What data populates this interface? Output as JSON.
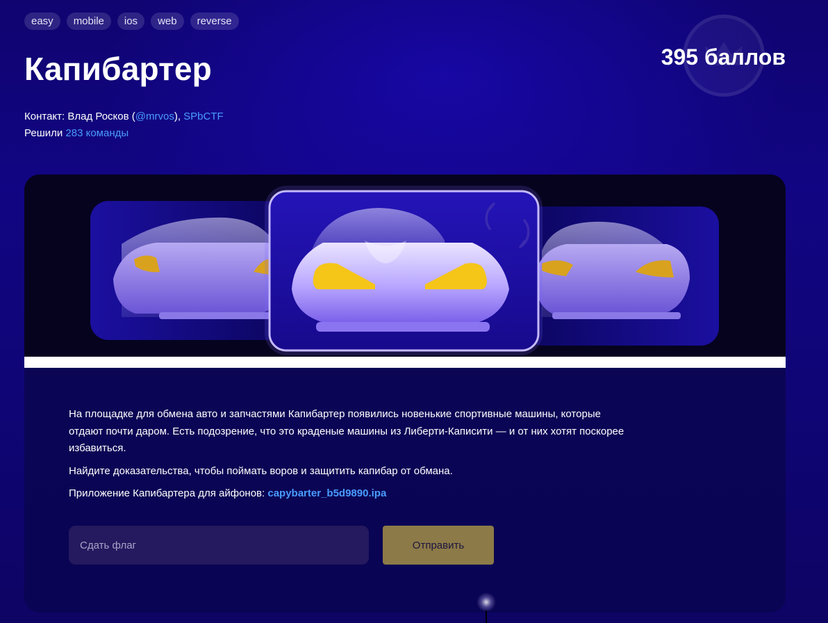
{
  "tags": [
    "easy",
    "mobile",
    "ios",
    "web",
    "reverse"
  ],
  "title": "Капибартер",
  "points": "395 баллов",
  "badge_icon": "crown-icon",
  "meta": {
    "contact_prefix": "Контакт: Влад Росков (",
    "contact_handle": "@mrvos",
    "contact_sep": "), ",
    "contact_org": "SPbCTF",
    "solved_prefix": "Решили ",
    "solved_count": "283 команды"
  },
  "banner": {
    "image": "sports-cars-illustration",
    "refresh_icon": "refresh-icon"
  },
  "description": {
    "p1": "На площадке для обмена авто и запчастями Капибартер появились новенькие спортивные машины, которые отдают почти даром. Есть подозрение, что это краденые машины из Либерти-Каписити — и от них хотят поскорее избавиться.",
    "p2": "Найдите доказательства, чтобы поймать воров и защитить капибар от обмана.",
    "p3_prefix": "Приложение Капибартера для айфонов: ",
    "p3_link": "capybarter_b5d9890.ipa"
  },
  "form": {
    "placeholder": "Сдать флаг",
    "value": "",
    "submit_label": "Отправить"
  },
  "colors": {
    "background": "#100577",
    "link": "#4a9bff",
    "submit": "#8c7a48",
    "input": "#25195f",
    "headlight": "#f5c518"
  }
}
